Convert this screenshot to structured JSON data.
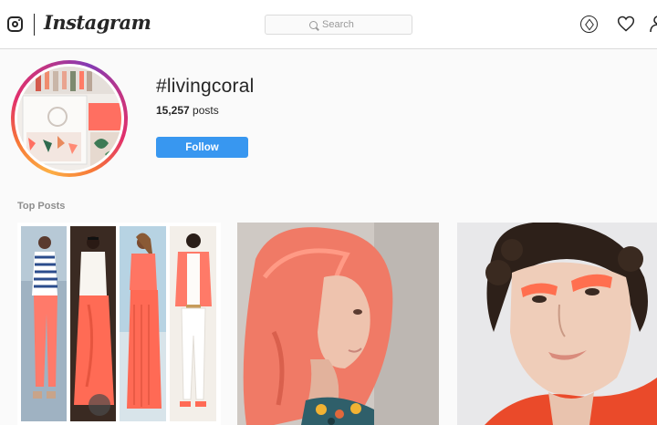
{
  "nav": {
    "brand": "Instagram",
    "search_placeholder": "Search",
    "icons": [
      "instagram-glyph-icon",
      "search-icon",
      "compass-icon",
      "heart-icon",
      "profile-icon"
    ]
  },
  "hashtag": {
    "title": "#livingcoral",
    "post_count": "15,257",
    "post_count_suffix": " posts",
    "follow_label": "Follow"
  },
  "sections": {
    "top_posts_label": "Top Posts"
  },
  "colors": {
    "accent_blue": "#3897f0",
    "living_coral": "#ff6f61",
    "text": "#262626",
    "muted": "#8e8e8e",
    "border": "#dbdbdb"
  },
  "posts": [
    {
      "kind": "outfit-collage",
      "panels": 4
    },
    {
      "kind": "coral-hair-portrait"
    },
    {
      "kind": "coral-eyeshadow-portrait"
    }
  ]
}
